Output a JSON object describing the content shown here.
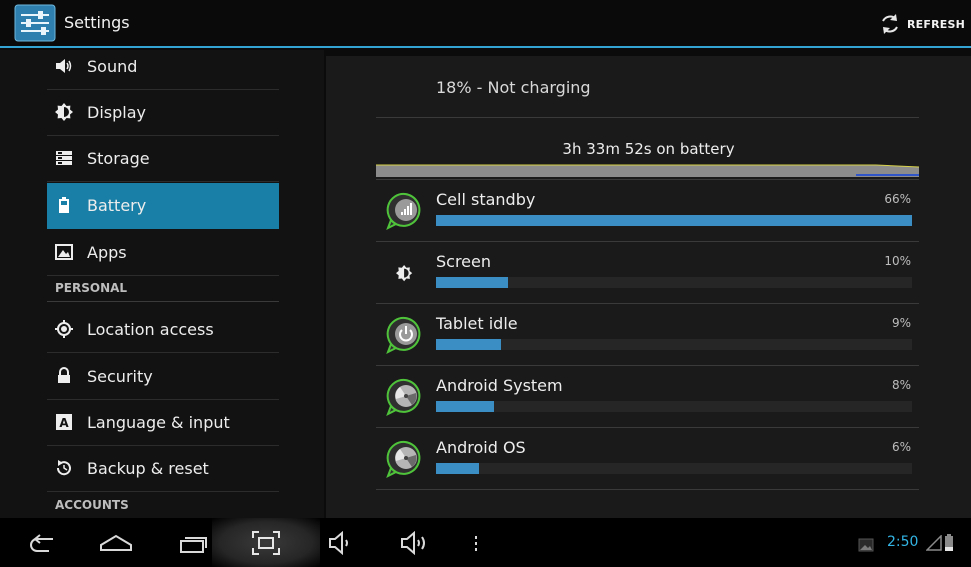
{
  "header": {
    "title": "Settings",
    "refresh_label": "REFRESH"
  },
  "sidebar": {
    "items": [
      {
        "label": "Sound",
        "icon": "speaker-icon"
      },
      {
        "label": "Display",
        "icon": "brightness-icon"
      },
      {
        "label": "Storage",
        "icon": "storage-icon"
      },
      {
        "label": "Battery",
        "icon": "battery-icon",
        "selected": true
      },
      {
        "label": "Apps",
        "icon": "apps-icon"
      },
      {
        "label": "Location access",
        "icon": "location-icon"
      },
      {
        "label": "Security",
        "icon": "lock-icon"
      },
      {
        "label": "Language & input",
        "icon": "keyboard-icon"
      },
      {
        "label": "Backup & reset",
        "icon": "backup-icon"
      }
    ],
    "headers": [
      "PERSONAL",
      "ACCOUNTS"
    ]
  },
  "battery": {
    "status": "18% - Not charging",
    "duration": "3h 33m 52s on battery",
    "usage": [
      {
        "label": "Cell standby",
        "percent": "66%",
        "value": 66,
        "icon": "cell-signal-icon"
      },
      {
        "label": "Screen",
        "percent": "10%",
        "value": 10,
        "icon": "screen-brightness-icon"
      },
      {
        "label": "Tablet idle",
        "percent": "9%",
        "value": 9,
        "icon": "power-icon"
      },
      {
        "label": "Android System",
        "percent": "8%",
        "value": 8,
        "icon": "android-system-icon"
      },
      {
        "label": "Android OS",
        "percent": "6%",
        "value": 6,
        "icon": "android-os-icon"
      }
    ]
  },
  "statusbar": {
    "time": "2:50"
  },
  "colors": {
    "accent": "#33a3d3",
    "selected": "#1a7fa6",
    "bar": "#3b8ec4"
  }
}
